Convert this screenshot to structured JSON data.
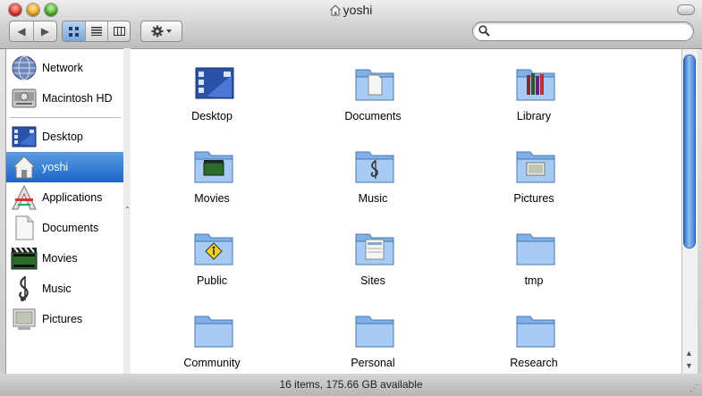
{
  "window": {
    "title": "yoshi"
  },
  "toolbar": {
    "back_label": "◀",
    "forward_label": "▶",
    "views": [
      "icon",
      "list",
      "column"
    ],
    "selected_view": "icon",
    "action_label": "Action",
    "search": {
      "value": "",
      "placeholder": ""
    }
  },
  "sidebar": {
    "devices": [
      {
        "label": "Network",
        "icon": "network-globe-icon"
      },
      {
        "label": "Macintosh HD",
        "icon": "hard-drive-icon"
      }
    ],
    "places": [
      {
        "label": "Desktop",
        "icon": "desktop-icon"
      },
      {
        "label": "yoshi",
        "icon": "home-icon",
        "selected": true
      },
      {
        "label": "Applications",
        "icon": "applications-icon"
      },
      {
        "label": "Documents",
        "icon": "documents-icon"
      },
      {
        "label": "Movies",
        "icon": "movies-icon"
      },
      {
        "label": "Music",
        "icon": "music-icon"
      },
      {
        "label": "Pictures",
        "icon": "pictures-icon"
      }
    ]
  },
  "content": {
    "items": [
      {
        "name": "Desktop",
        "icon": "desktop-icon"
      },
      {
        "name": "Documents",
        "icon": "documents-folder-icon"
      },
      {
        "name": "Library",
        "icon": "library-folder-icon"
      },
      {
        "name": "Movies",
        "icon": "movies-folder-icon"
      },
      {
        "name": "Music",
        "icon": "music-folder-icon"
      },
      {
        "name": "Pictures",
        "icon": "pictures-folder-icon"
      },
      {
        "name": "Public",
        "icon": "public-folder-icon"
      },
      {
        "name": "Sites",
        "icon": "sites-folder-icon"
      },
      {
        "name": "tmp",
        "icon": "folder-icon"
      },
      {
        "name": "Community",
        "icon": "folder-icon"
      },
      {
        "name": "Personal",
        "icon": "folder-icon"
      },
      {
        "name": "Research",
        "icon": "folder-icon"
      }
    ]
  },
  "status": {
    "text": "16 items, 175.66 GB available"
  },
  "colors": {
    "selection": "#1b65c7",
    "folder": "#7fb0e8"
  }
}
